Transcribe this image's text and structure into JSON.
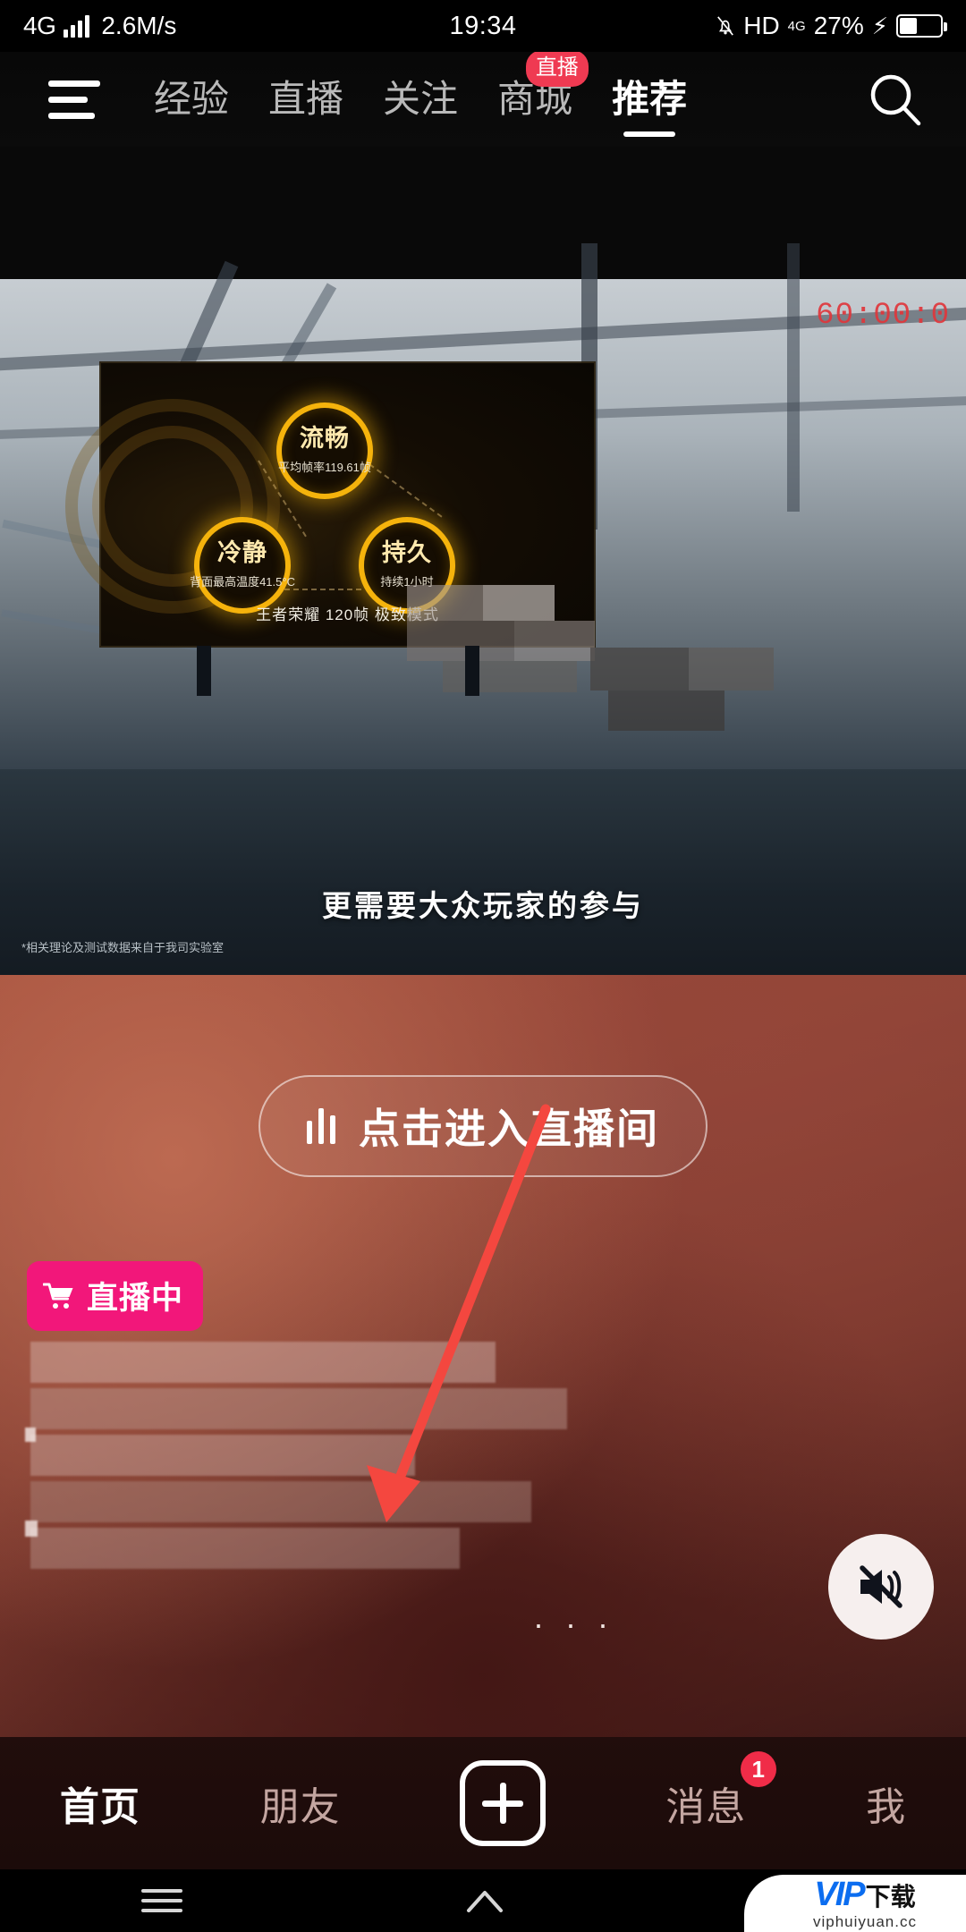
{
  "status_bar": {
    "network_type": "4G",
    "speed": "2.6M/s",
    "time": "19:34",
    "hd_label": "HD",
    "data_label": "4G",
    "battery_percent": "27%",
    "icons": {
      "signal": "signal-bars-icon",
      "mute_bell": "bell-off-icon",
      "charging": "charging-bolt-icon"
    }
  },
  "top_nav": {
    "menu_icon": "hamburger-menu-icon",
    "search_icon": "search-icon",
    "tabs": [
      {
        "label": "经验",
        "active": false,
        "badge": null
      },
      {
        "label": "直播",
        "active": false,
        "badge": null
      },
      {
        "label": "关注",
        "active": false,
        "badge": null
      },
      {
        "label": "商城",
        "active": false,
        "badge": "直播"
      },
      {
        "label": "推荐",
        "active": true,
        "badge": null
      }
    ]
  },
  "video": {
    "timer": "60:00:0",
    "caption": "更需要大众玩家的参与",
    "footnote": "*相关理论及测试数据来自于我司实验室",
    "panel": {
      "caption": "王者荣耀 120帧 极致模式",
      "nodes": [
        {
          "title": "流畅",
          "sub": "平均帧率119.61帧"
        },
        {
          "title": "冷静",
          "sub": "背面最高温度41.5°C"
        },
        {
          "title": "持久",
          "sub": "持续1小时"
        }
      ]
    }
  },
  "live_card": {
    "enter_button": {
      "label": "点击进入直播间",
      "icon": "sound-bars-icon"
    },
    "live_badge": {
      "label": "直播中",
      "icon": "shopping-cart-icon",
      "color": "#f2177a"
    },
    "ellipsis": "· · ·",
    "mute_button": {
      "icon": "speaker-muted-icon"
    }
  },
  "bottom_nav": {
    "items": [
      {
        "label": "首页",
        "active": true,
        "badge": null
      },
      {
        "label": "朋友",
        "active": false,
        "badge": null
      },
      {
        "label": "",
        "active": false,
        "badge": null,
        "icon": "plus-icon"
      },
      {
        "label": "消息",
        "active": false,
        "badge": "1"
      },
      {
        "label": "我",
        "active": false,
        "badge": null
      }
    ]
  },
  "android_nav": {
    "recent_icon": "recent-apps-icon",
    "home_icon": "home-icon",
    "back_icon": "back-icon"
  },
  "watermark": {
    "brand": "VIP",
    "suffix": "下载",
    "url": "viphuiyuan.cc"
  },
  "colors": {
    "badge_pink": "#f2177a",
    "tab_badge_red": "#ef3a52",
    "nav_badge_red": "#f02c48",
    "accent_yellow": "#f5b30c",
    "arrow_red": "#f4473f"
  }
}
